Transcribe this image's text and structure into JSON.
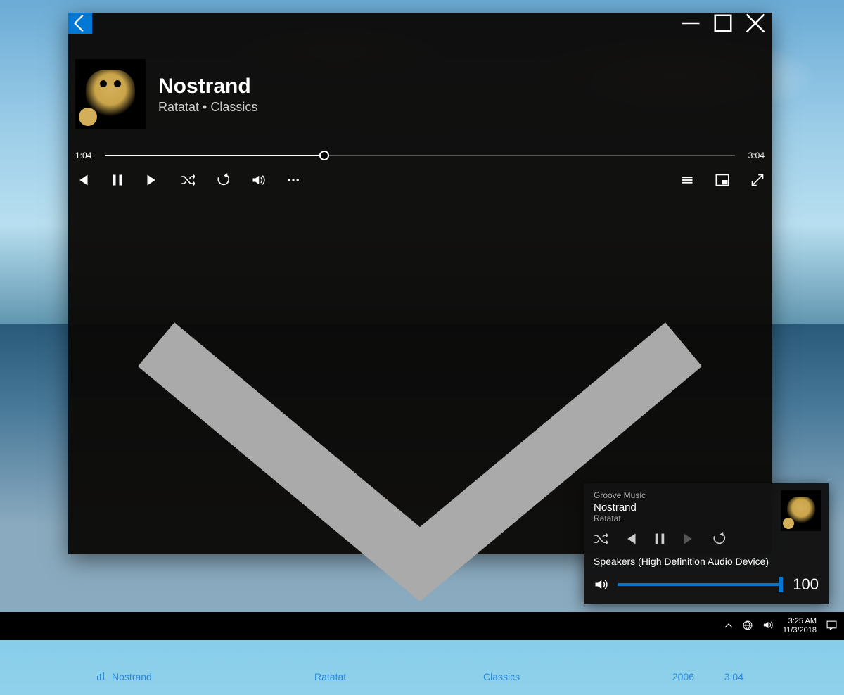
{
  "track": {
    "title": "Nostrand",
    "artist": "Ratatat",
    "album": "Classics",
    "subtitle": "Ratatat • Classics"
  },
  "progress": {
    "elapsed": "1:04",
    "total": "3:04",
    "percent": 34.8
  },
  "queue": [
    {
      "title": "Nostrand",
      "artist": "Ratatat",
      "album": "Classics",
      "year": "2006",
      "duration": "3:04"
    }
  ],
  "flyout": {
    "app_name": "Groove Music",
    "track": "Nostrand",
    "artist": "Ratatat",
    "device": "Speakers (High Definition Audio Device)",
    "volume": 100
  },
  "taskbar": {
    "time": "3:25 AM",
    "date": "11/3/2018"
  },
  "colors": {
    "accent": "#0078d4",
    "link": "#2b88d8"
  }
}
